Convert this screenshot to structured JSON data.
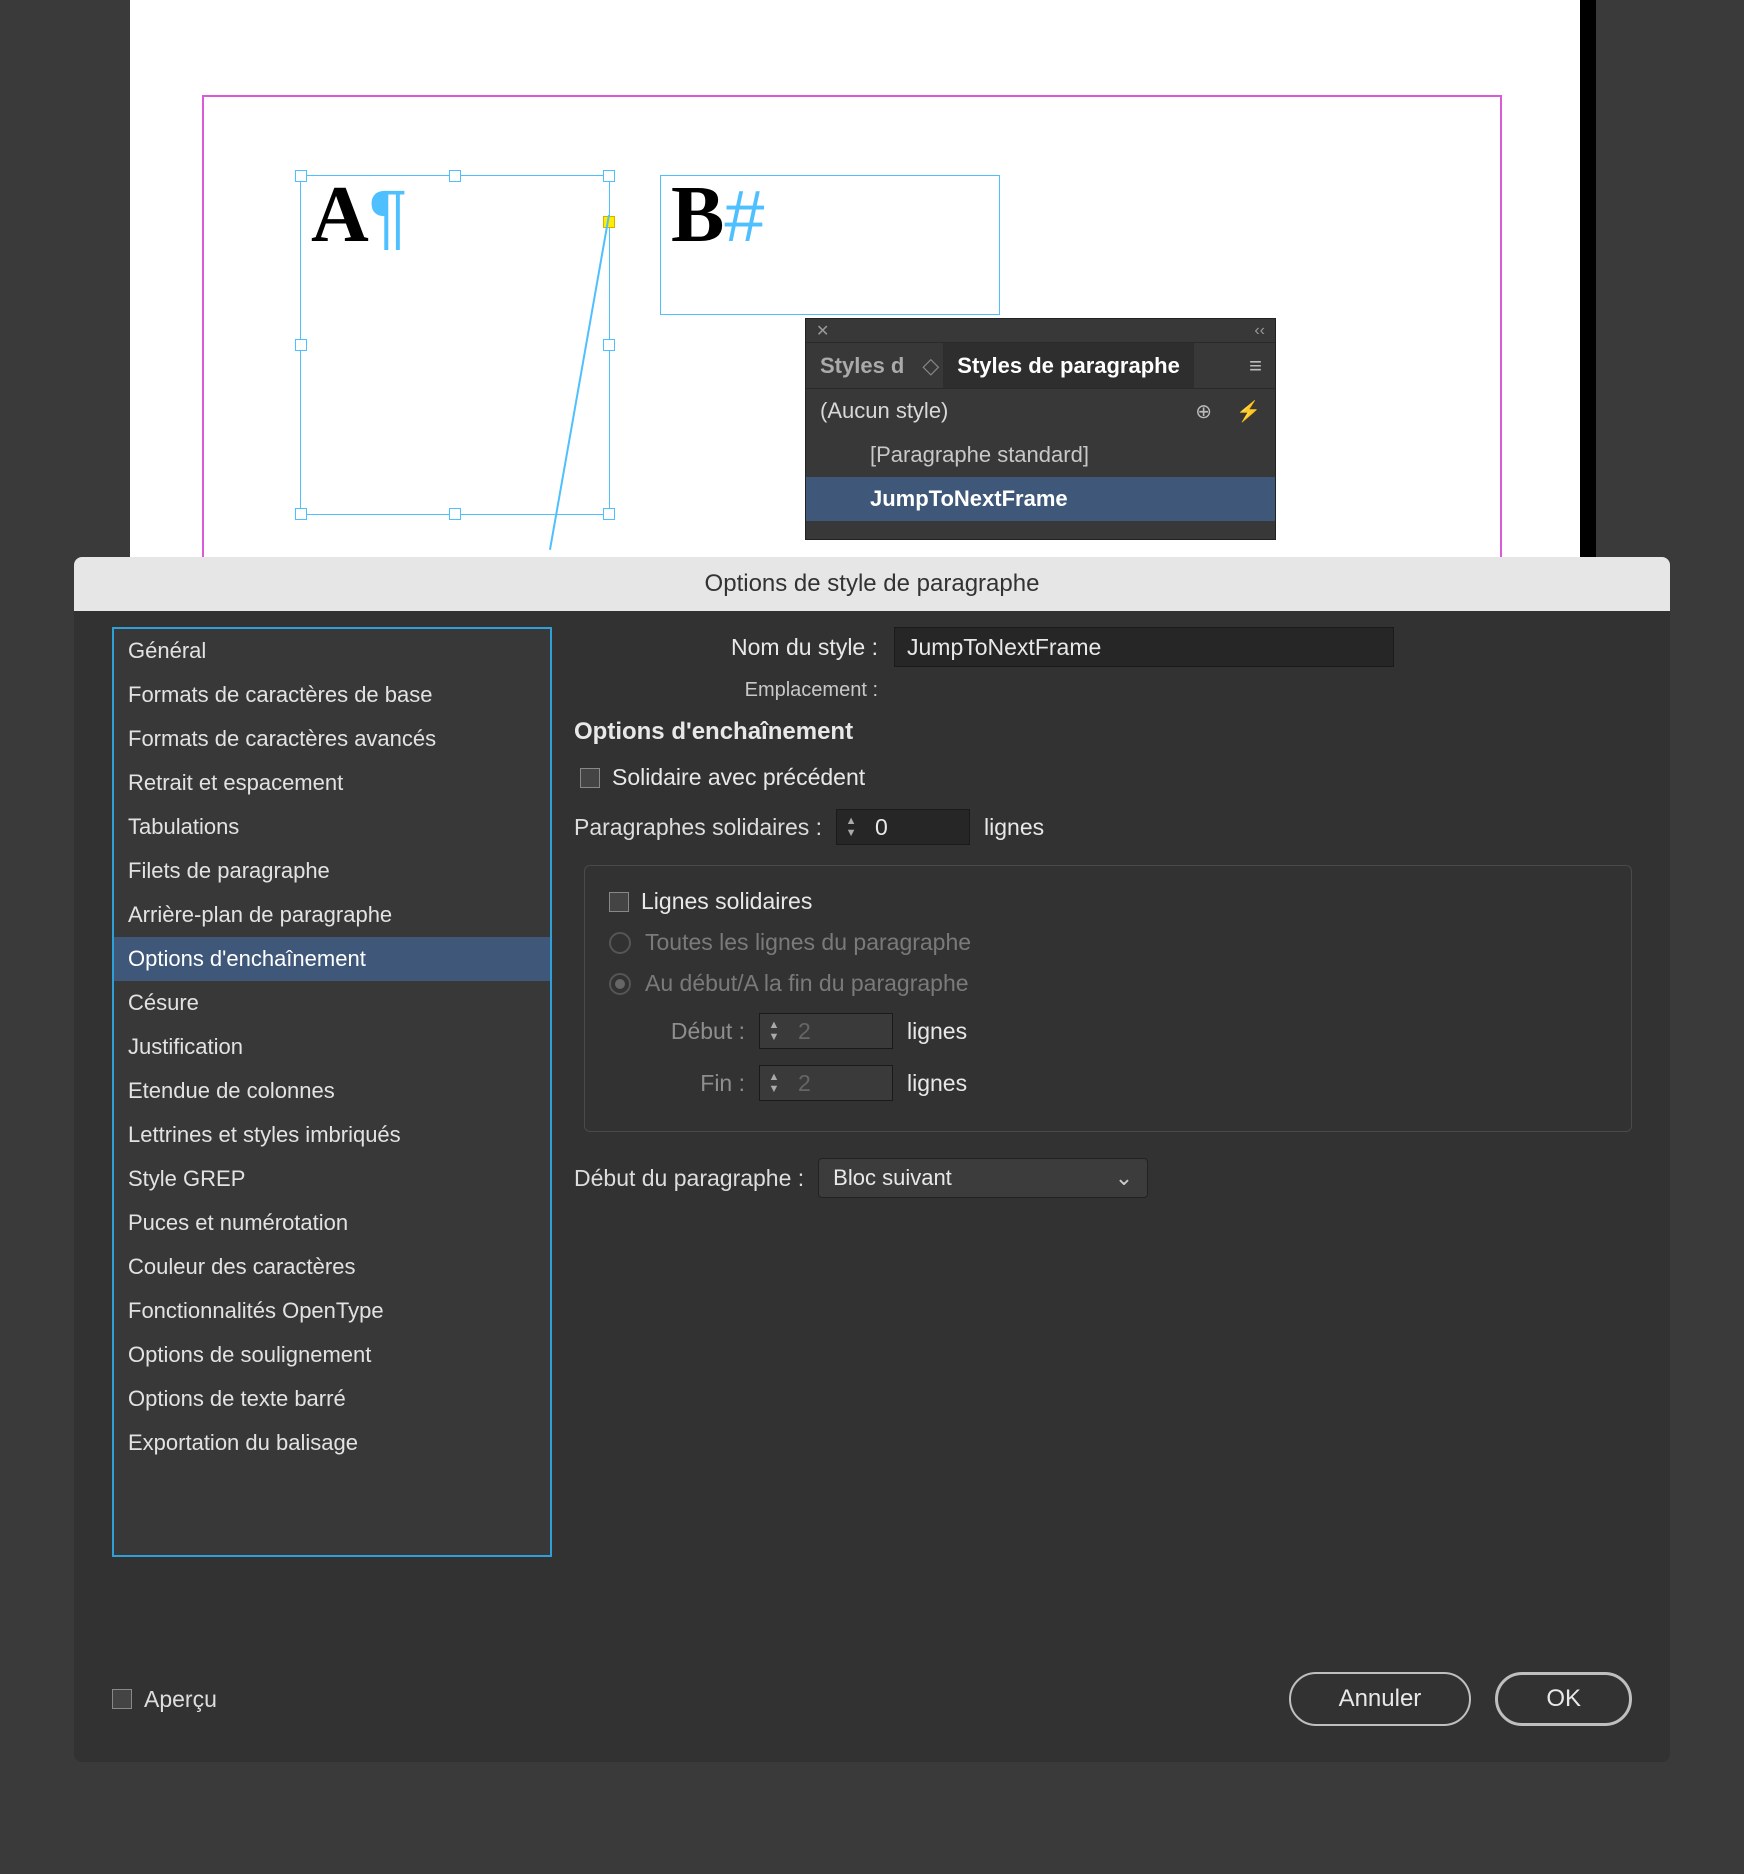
{
  "document": {
    "frameA": "A",
    "frameB": "B"
  },
  "panel": {
    "tab_truncated": "Styles d",
    "tab_active": "Styles de paragraphe",
    "none_style": "(Aucun style)",
    "items": [
      "[Paragraphe standard]",
      "JumpToNextFrame"
    ]
  },
  "dialog": {
    "title": "Options de style de paragraphe",
    "sidebar": [
      "Général",
      "Formats de caractères de base",
      "Formats de caractères avancés",
      "Retrait et espacement",
      "Tabulations",
      "Filets de paragraphe",
      "Arrière-plan de paragraphe",
      "Options d'enchaînement",
      "Césure",
      "Justification",
      "Etendue de colonnes",
      "Lettrines et styles imbriqués",
      "Style GREP",
      "Puces et numérotation",
      "Couleur des caractères",
      "Fonctionnalités OpenType",
      "Options de soulignement",
      "Options de texte barré",
      "Exportation du balisage"
    ],
    "sidebar_selected": 7,
    "name_label": "Nom du style :",
    "name_value": "JumpToNextFrame",
    "location_label": "Emplacement :",
    "section": "Options d'enchaînement",
    "keep_prev": "Solidaire avec précédent",
    "keep_next_label": "Paragraphes solidaires :",
    "keep_next_value": "0",
    "lines_word": "lignes",
    "keep_lines": "Lignes solidaires",
    "all_lines": "Toutes les lignes du paragraphe",
    "start_end": "Au début/A la fin du paragraphe",
    "start_label": "Début :",
    "start_value": "2",
    "end_label": "Fin :",
    "end_value": "2",
    "para_start_label": "Début du paragraphe :",
    "para_start_value": "Bloc suivant",
    "preview": "Aperçu",
    "cancel": "Annuler",
    "ok": "OK"
  }
}
